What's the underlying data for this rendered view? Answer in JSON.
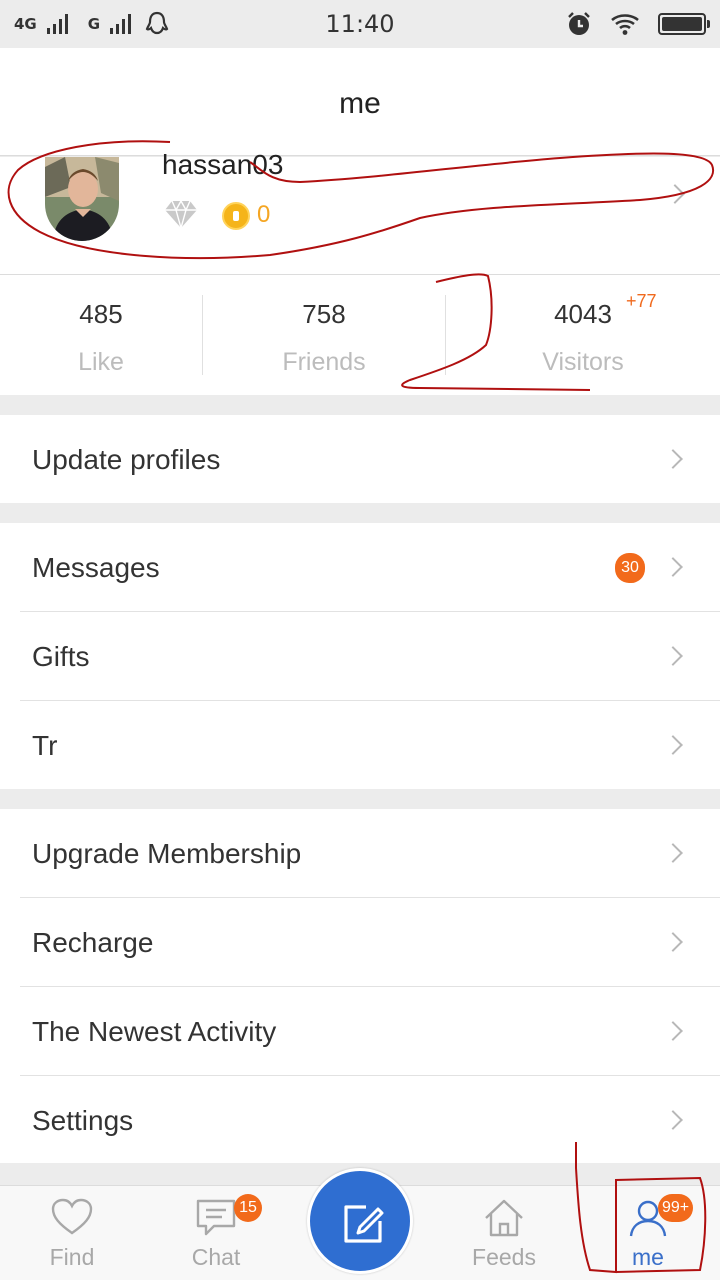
{
  "status_bar": {
    "network1": "4G",
    "network2": "G",
    "time": "11:40"
  },
  "header": {
    "title": "me"
  },
  "profile": {
    "username": "hassan03",
    "coins": "0"
  },
  "stats": [
    {
      "value": "485",
      "label": "Like"
    },
    {
      "value": "758",
      "label": "Friends"
    },
    {
      "value": "4043",
      "label": "Visitors",
      "delta": "+77"
    }
  ],
  "menu": {
    "update_profiles": "Update profiles",
    "messages": "Messages",
    "messages_badge": "30",
    "gifts": "Gifts",
    "tr": "Tr",
    "upgrade_membership": "Upgrade Membership",
    "recharge": "Recharge",
    "newest_activity": "The Newest Activity",
    "settings": "Settings"
  },
  "tabbar": {
    "find": "Find",
    "chat": "Chat",
    "chat_badge": "15",
    "feeds": "Feeds",
    "me": "me",
    "me_badge": "99+",
    "active": "me"
  },
  "colors": {
    "accent_blue": "#2f6ed1",
    "badge_orange": "#f26a1b",
    "coin_gold": "#f5a623",
    "annotation_red": "#b01010"
  }
}
